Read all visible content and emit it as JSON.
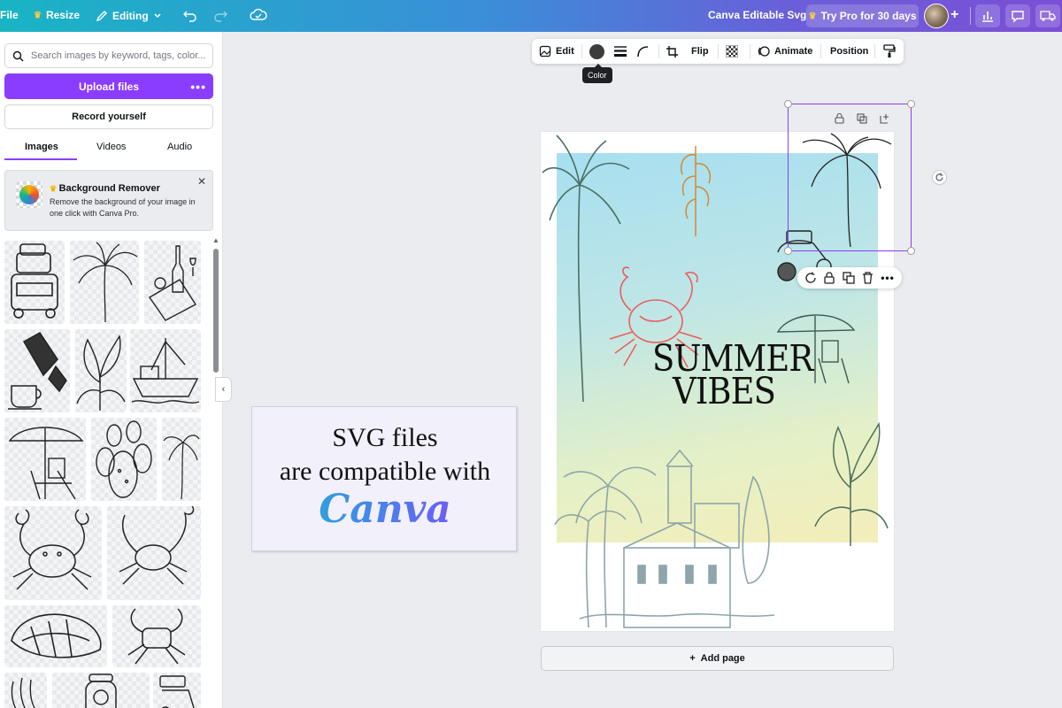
{
  "topbar": {
    "file_label": "File",
    "resize_label": "Resize",
    "editing_label": "Editing",
    "doc_title": "Canva Editable Svg",
    "pro_label": "Try Pro for 30 days"
  },
  "panel": {
    "search_placeholder": "Search images by keyword, tags, color...",
    "upload_label": "Upload files",
    "upload_more": "•••",
    "record_label": "Record yourself",
    "tabs": [
      {
        "label": "Images",
        "active": true
      },
      {
        "label": "Videos",
        "active": false
      },
      {
        "label": "Audio",
        "active": false
      }
    ],
    "promo": {
      "title": "Background Remover",
      "text": "Remove the background of your image in one click with Canva Pro."
    }
  },
  "toolbar": {
    "edit_label": "Edit",
    "flip_label": "Flip",
    "animate_label": "Animate",
    "position_label": "Position",
    "color_tooltip": "Color",
    "color_value": "#3c3c3c"
  },
  "canvas": {
    "headline_line1": "SUMMER",
    "headline_line2": "VIBES",
    "add_page_label": "Add page"
  },
  "overlay": {
    "line1": "SVG files",
    "line2": "are compatible with",
    "logo": "Canva"
  },
  "colors": {
    "accent": "#8b3dff",
    "topbar_start": "#19b4c4",
    "topbar_end": "#7b4fd6"
  }
}
